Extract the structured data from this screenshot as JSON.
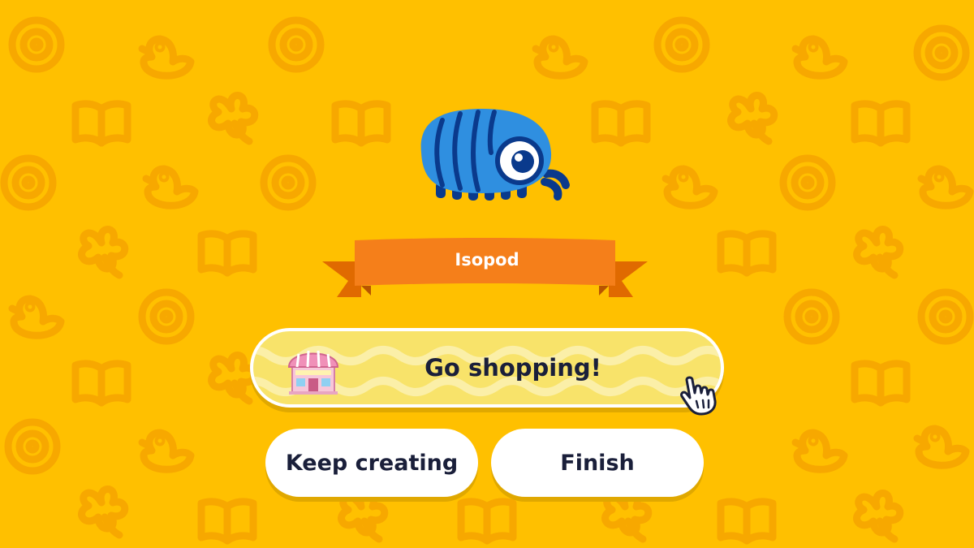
{
  "result": {
    "creature_name": "Isopod",
    "creature_icon": "isopod-icon"
  },
  "actions": {
    "shop_label": "Go shopping!",
    "shop_icon": "shop-building-icon",
    "keep_creating_label": "Keep creating",
    "finish_label": "Finish"
  },
  "colors": {
    "background": "#FFC000",
    "pattern": "#F7A800",
    "ribbon": "#F57F1A",
    "creature_body": "#2F8FE0",
    "shop_button": "#F8E36A",
    "text": "#1A1F3A"
  },
  "background_pattern_icons": [
    "duck-icon",
    "disc-icon",
    "book-icon",
    "clover-icon"
  ]
}
